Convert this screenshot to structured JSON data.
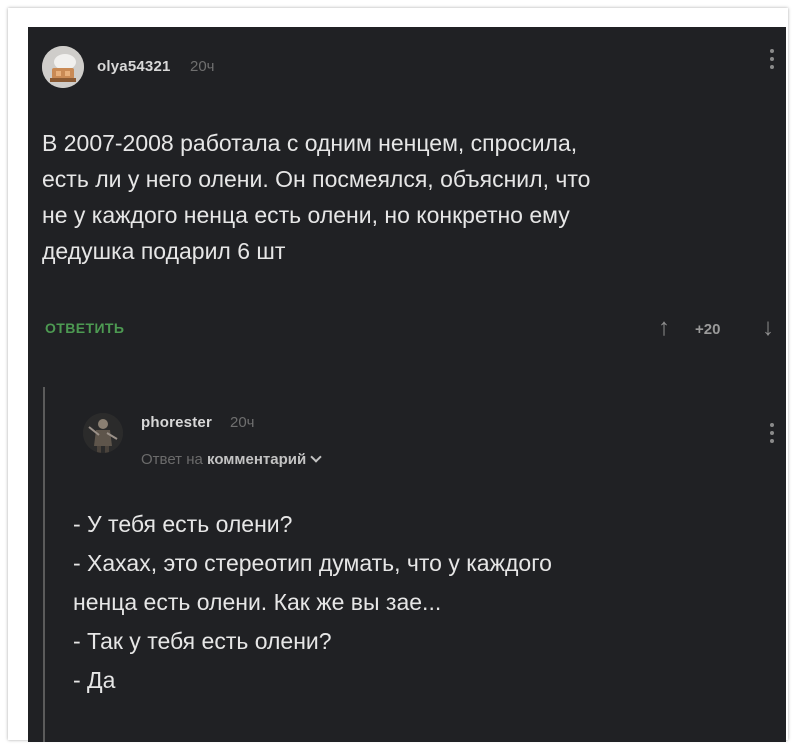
{
  "comment": {
    "username": "olya54321",
    "time": "20ч",
    "lines": [
      "В 2007-2008 работала с одним ненцем, спросила,",
      "есть ли у него олени. Он посмеялся, объяснил, что",
      "не у каждого ненца есть олени, но конкретно ему",
      "дедушка подарил 6 шт"
    ],
    "reply_label": "ОТВЕТИТЬ",
    "score": "+20",
    "upvote_icon": "↑",
    "downvote_icon": "↓",
    "accent_color": "#4d9a52"
  },
  "reply": {
    "username": "phorester",
    "time": "20ч",
    "reply_to_prefix": "Ответ на",
    "reply_to_link": "комментарий",
    "lines": [
      "- У тебя есть олени?",
      "- Хахах, это стереотип думать, что у каждого",
      "ненца есть олени. Как же вы зае...",
      "- Так у тебя есть олени?",
      "- Да"
    ]
  }
}
